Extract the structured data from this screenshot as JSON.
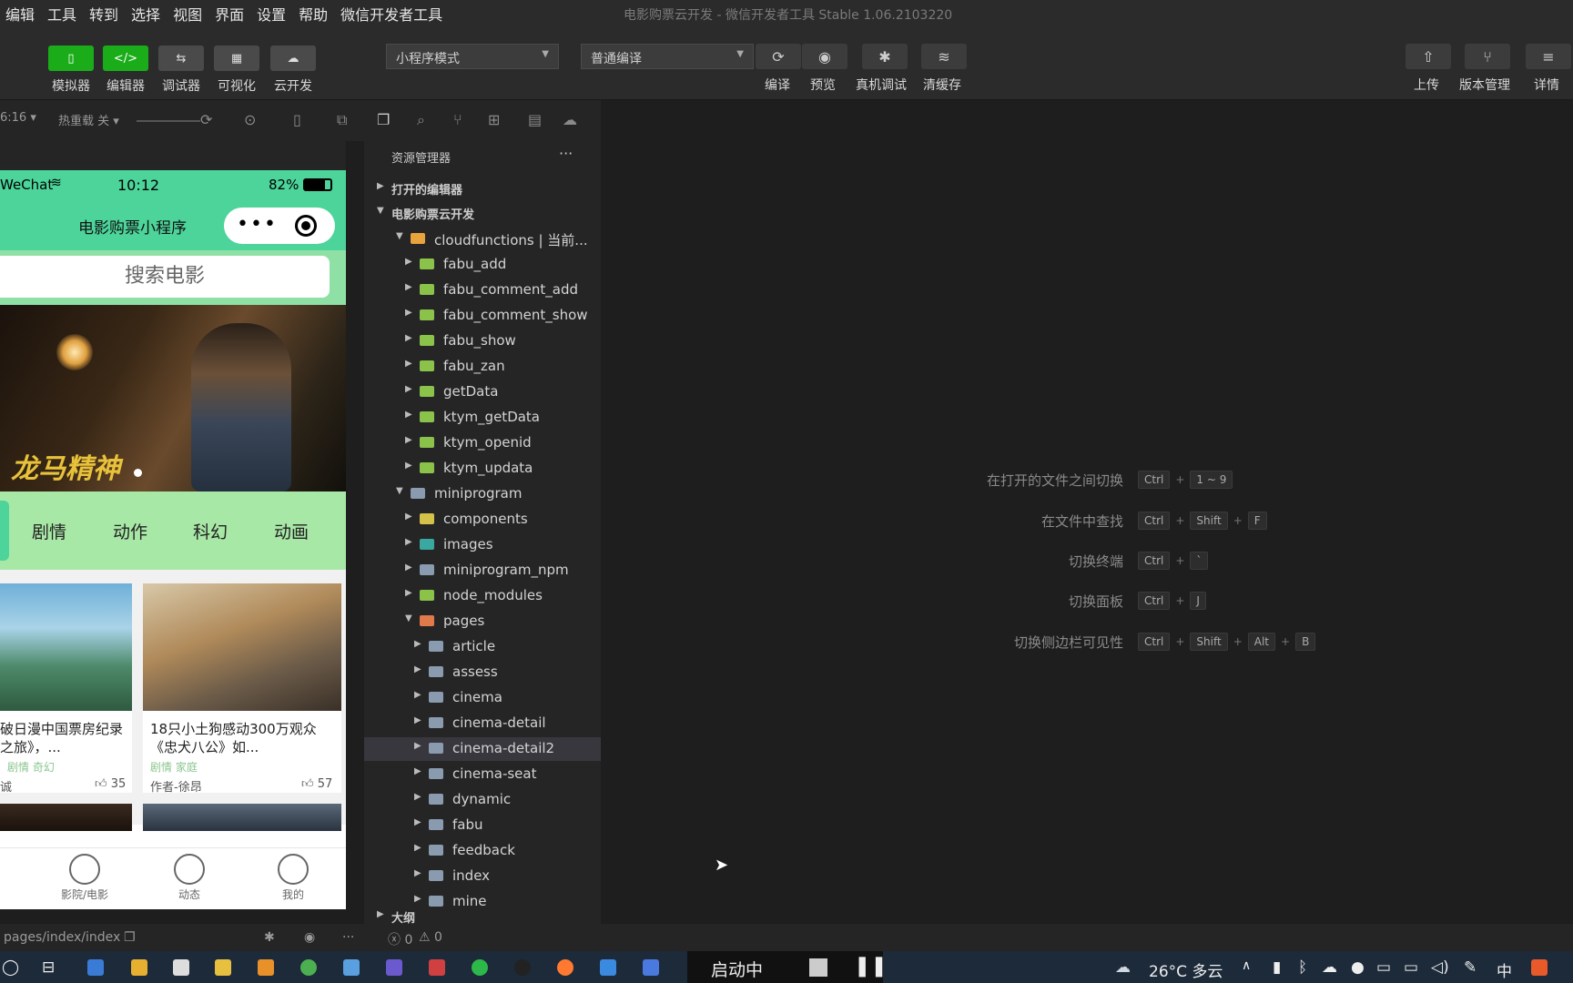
{
  "menu": [
    "编辑",
    "工具",
    "转到",
    "选择",
    "视图",
    "界面",
    "设置",
    "帮助",
    "微信开发者工具"
  ],
  "window_title": "电影购票云开发 - 微信开发者工具 Stable 1.06.2103220",
  "toolbar": {
    "left_buttons": [
      "模拟器",
      "编辑器",
      "调试器",
      "可视化",
      "云开发"
    ],
    "mode_select": "小程序模式",
    "compile_select": "普通编译",
    "mid_labels": [
      "编译",
      "预览",
      "真机调试",
      "清缓存"
    ],
    "right_labels": [
      "上传",
      "版本管理",
      "详情"
    ]
  },
  "subbar": {
    "zoom": "6:16 ▾",
    "hotreload": "热重载 关 ▾"
  },
  "phone": {
    "carrier": "WeChat",
    "time": "10:12",
    "battery": "82%",
    "nav_title": "电影购票小程序",
    "search_placeholder": "搜索电影",
    "categories": [
      "剧情",
      "动作",
      "科幻",
      "动画"
    ],
    "cards": [
      {
        "title_line1": "破日漫中国票房纪录",
        "title_line2": "之旅》，...",
        "tags": "剧情 奇幻",
        "author": "诚",
        "likes": "35"
      },
      {
        "title_line1": "18只小土狗感动300万观众",
        "title_line2": "《忠犬八公》如...",
        "tags": "剧情 家庭",
        "author": "作者-徐昂",
        "likes": "57"
      }
    ],
    "tabs": [
      "影院/电影",
      "动态",
      "我的"
    ]
  },
  "explorer": {
    "title": "资源管理器",
    "more": "···",
    "sections": [
      "打开的编辑器",
      "电影购票云开发",
      "大纲"
    ],
    "tree": [
      {
        "name": "cloudfunctions | 当前...",
        "level": 0,
        "open": true,
        "color": "#e8a33d"
      },
      {
        "name": "fabu_add",
        "level": 1,
        "open": false,
        "color": "#8bc34a"
      },
      {
        "name": "fabu_comment_add",
        "level": 1,
        "open": false,
        "color": "#8bc34a"
      },
      {
        "name": "fabu_comment_show",
        "level": 1,
        "open": false,
        "color": "#8bc34a"
      },
      {
        "name": "fabu_show",
        "level": 1,
        "open": false,
        "color": "#8bc34a"
      },
      {
        "name": "fabu_zan",
        "level": 1,
        "open": false,
        "color": "#8bc34a"
      },
      {
        "name": "getData",
        "level": 1,
        "open": false,
        "color": "#8bc34a"
      },
      {
        "name": "ktym_getData",
        "level": 1,
        "open": false,
        "color": "#8bc34a"
      },
      {
        "name": "ktym_openid",
        "level": 1,
        "open": false,
        "color": "#8bc34a"
      },
      {
        "name": "ktym_updata",
        "level": 1,
        "open": false,
        "color": "#8bc34a"
      },
      {
        "name": "miniprogram",
        "level": 0,
        "open": true,
        "color": "#8a9bb0"
      },
      {
        "name": "components",
        "level": 1,
        "open": false,
        "color": "#d4c14a"
      },
      {
        "name": "images",
        "level": 1,
        "open": false,
        "color": "#3aa7a0"
      },
      {
        "name": "miniprogram_npm",
        "level": 1,
        "open": false,
        "color": "#8a9bb0"
      },
      {
        "name": "node_modules",
        "level": 1,
        "open": false,
        "color": "#8bc34a"
      },
      {
        "name": "pages",
        "level": 1,
        "open": true,
        "color": "#e07a4a"
      },
      {
        "name": "article",
        "level": 2,
        "open": false,
        "color": "#8a9bb0"
      },
      {
        "name": "assess",
        "level": 2,
        "open": false,
        "color": "#8a9bb0"
      },
      {
        "name": "cinema",
        "level": 2,
        "open": false,
        "color": "#8a9bb0"
      },
      {
        "name": "cinema-detail",
        "level": 2,
        "open": false,
        "color": "#8a9bb0"
      },
      {
        "name": "cinema-detail2",
        "level": 2,
        "open": false,
        "color": "#8a9bb0",
        "selected": true
      },
      {
        "name": "cinema-seat",
        "level": 2,
        "open": false,
        "color": "#8a9bb0"
      },
      {
        "name": "dynamic",
        "level": 2,
        "open": false,
        "color": "#8a9bb0"
      },
      {
        "name": "fabu",
        "level": 2,
        "open": false,
        "color": "#8a9bb0"
      },
      {
        "name": "feedback",
        "level": 2,
        "open": false,
        "color": "#8a9bb0"
      },
      {
        "name": "index",
        "level": 2,
        "open": false,
        "color": "#8a9bb0"
      },
      {
        "name": "mine",
        "level": 2,
        "open": false,
        "color": "#8a9bb0"
      }
    ]
  },
  "shortcuts": [
    {
      "label": "在打开的文件之间切换",
      "keys": [
        "Ctrl",
        "1 ~ 9"
      ]
    },
    {
      "label": "在文件中查找",
      "keys": [
        "Ctrl",
        "Shift",
        "F"
      ]
    },
    {
      "label": "切换终端",
      "keys": [
        "Ctrl",
        "`"
      ]
    },
    {
      "label": "切换面板",
      "keys": [
        "Ctrl",
        "J"
      ]
    },
    {
      "label": "切换侧边栏可见性",
      "keys": [
        "Ctrl",
        "Shift",
        "Alt",
        "B"
      ]
    }
  ],
  "devstatus": {
    "path": "pages/index/index",
    "errors": "0",
    "warnings": "0"
  },
  "taskbar": {
    "running": "启动中",
    "weather": "26°C 多云",
    "ime": "中"
  },
  "colors": {
    "accent_green": "#1aad19",
    "phone_nav": "#4cd49a"
  }
}
